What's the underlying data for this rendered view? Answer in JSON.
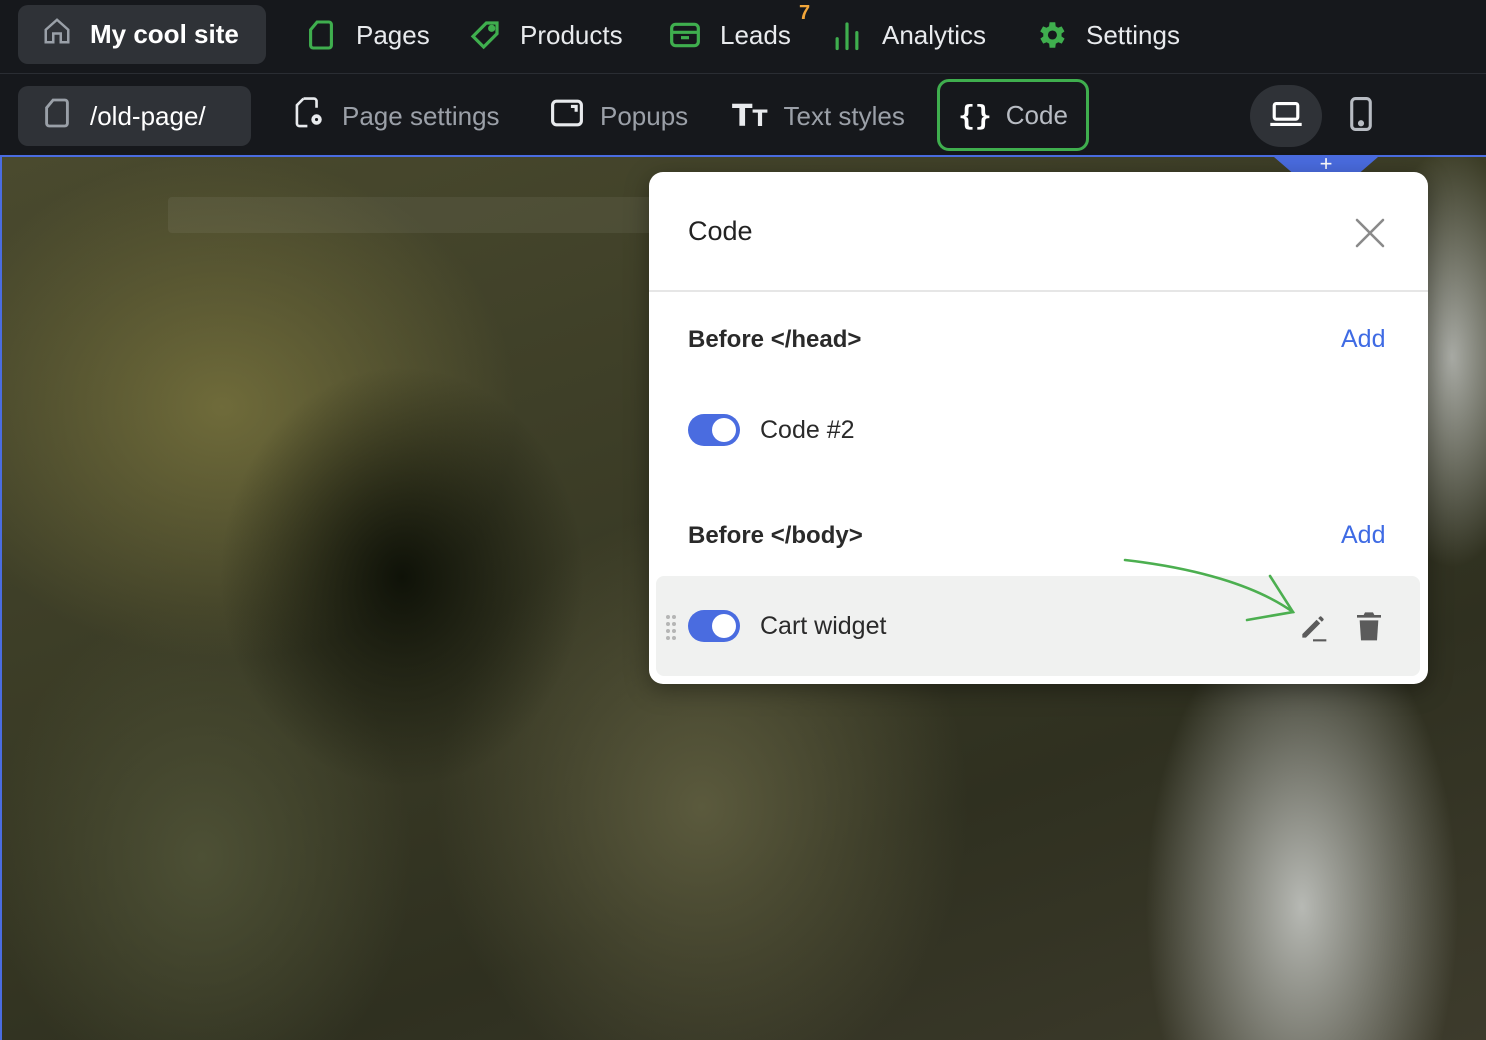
{
  "topbar": {
    "site_name": "My cool site",
    "nav": [
      {
        "label": "Pages",
        "icon": "page-icon"
      },
      {
        "label": "Products",
        "icon": "tag-icon"
      },
      {
        "label": "Leads",
        "icon": "inbox-icon",
        "badge": "7"
      },
      {
        "label": "Analytics",
        "icon": "bar-chart-icon"
      },
      {
        "label": "Settings",
        "icon": "gear-icon"
      }
    ]
  },
  "subbar": {
    "page_path": "/old-page/",
    "items": [
      {
        "label": "Page settings",
        "icon": "page-settings-icon"
      },
      {
        "label": "Popups",
        "icon": "popup-icon"
      },
      {
        "label": "Text styles",
        "icon": "text-styles-icon"
      },
      {
        "label": "Code",
        "icon": "braces-icon",
        "active": true
      }
    ],
    "views": [
      {
        "name": "desktop",
        "icon": "laptop-icon",
        "active": true
      },
      {
        "name": "mobile",
        "icon": "phone-icon",
        "active": false
      }
    ]
  },
  "canvas": {
    "plus": "+"
  },
  "modal": {
    "title": "Code",
    "sections": [
      {
        "label": "Before </head>",
        "add_label": "Add",
        "items": [
          {
            "label": "Code #2",
            "enabled": true
          }
        ]
      },
      {
        "label": "Before </body>",
        "add_label": "Add",
        "items": [
          {
            "label": "Cart widget",
            "enabled": true,
            "highlighted": true
          }
        ]
      }
    ]
  },
  "colors": {
    "accent_green": "#3fae4e",
    "link_blue": "#3f6be4",
    "toggle_blue": "#4a6ce0",
    "badge_orange": "#f2a63a",
    "nav_bg": "#16181c"
  }
}
